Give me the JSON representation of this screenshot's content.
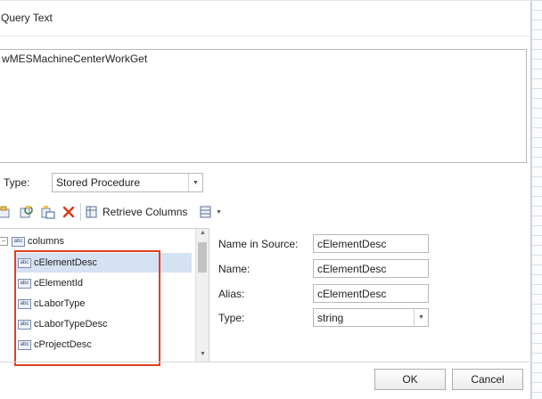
{
  "query_text": {
    "label": "Query Text",
    "value": "wMESMachineCenterWorkGet"
  },
  "type_field": {
    "label": "Type:",
    "value": "Stored Procedure"
  },
  "toolbar": {
    "icons": [
      "add-param-icon",
      "refresh-icon",
      "param-type-icon",
      "delete-icon"
    ],
    "retrieve_label": "Retrieve Columns",
    "extra_menu_icon": "table-options-icon"
  },
  "tree": {
    "root": "columns",
    "items": [
      "cElementDesc",
      "cElementId",
      "cLaborType",
      "cLaborTypeDesc",
      "cProjectDesc"
    ],
    "selected_index": 0,
    "icon_text": "abc"
  },
  "properties": {
    "name_in_source_label": "Name in Source:",
    "name_in_source_value": "cElementDesc",
    "name_label": "Name:",
    "name_value": "cElementDesc",
    "alias_label": "Alias:",
    "alias_value": "cElementDesc",
    "type_label": "Type:",
    "type_value": "string"
  },
  "buttons": {
    "ok": "OK",
    "cancel": "Cancel"
  },
  "colors": {
    "highlight": "#e0401c",
    "selection": "#d5e2f3"
  }
}
